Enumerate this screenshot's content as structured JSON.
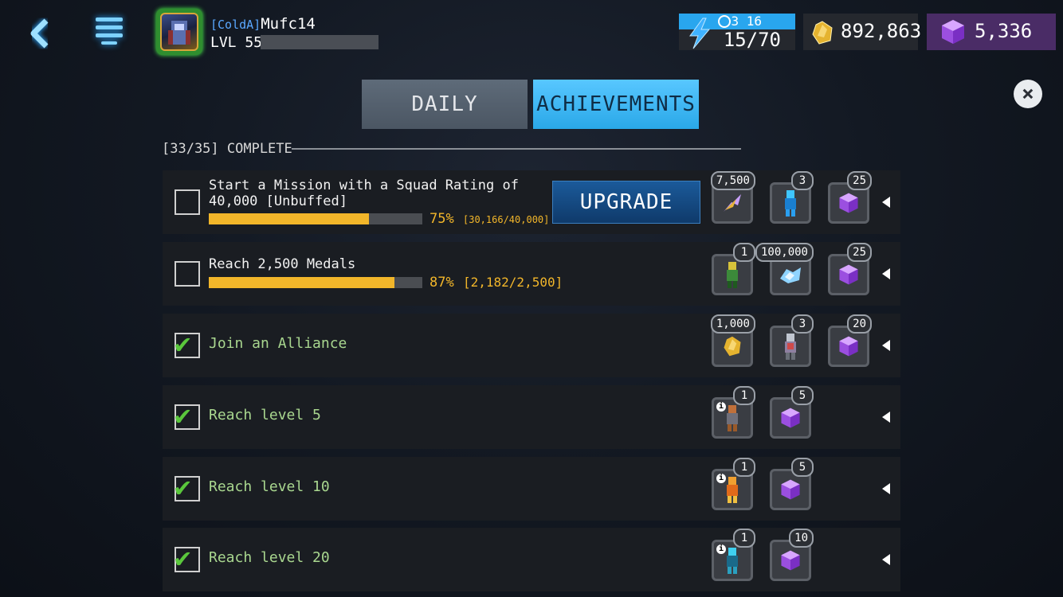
{
  "player": {
    "tag": "[ColdA]",
    "name": "Mufc14",
    "level": "LVL 55"
  },
  "energy": {
    "timer": "3 16",
    "value": "15/70"
  },
  "currency": {
    "gold": "892,863",
    "gems": "5,336"
  },
  "tabs": [
    {
      "label": "DAILY"
    },
    {
      "label": "ACHIEVEMENTS"
    }
  ],
  "completion": "[33/35] COMPLETE",
  "upgrade_label": "UPGRADE",
  "achievements": [
    {
      "title": "Start a Mission with a Squad Rating of 40,000 [Unbuffed]",
      "progress": 0.75,
      "percent": "75%",
      "progress_text": "[30,166/40,000]",
      "checked": false,
      "rewards": [
        {
          "icon": "gold-char-shard-icon",
          "qty": "7,500"
        },
        {
          "icon": "blue-character-icon",
          "qty": "3"
        },
        {
          "icon": "purple-gem-icon",
          "qty": "25"
        }
      ]
    },
    {
      "title": "Reach 2,500 Medals",
      "progress": 0.87,
      "percent": "87%",
      "progress_text": "[2,182/2,500]",
      "checked": false,
      "rewards": [
        {
          "icon": "green-character-icon",
          "qty": "1"
        },
        {
          "icon": "ore-crystal-icon",
          "qty": "100,000"
        },
        {
          "icon": "purple-gem-icon",
          "qty": "25"
        }
      ]
    },
    {
      "title": "Join an Alliance",
      "checked": true,
      "rewards": [
        {
          "icon": "gold-nugget-icon",
          "qty": "1,000"
        },
        {
          "icon": "silver-character-icon",
          "qty": "3"
        },
        {
          "icon": "purple-gem-icon",
          "qty": "20"
        }
      ]
    },
    {
      "title": "Reach level 5",
      "checked": true,
      "rewards": [
        {
          "icon": "orange-character-icon",
          "qty": "1"
        },
        {
          "icon": "purple-gem-icon",
          "qty": "5"
        }
      ]
    },
    {
      "title": "Reach level 10",
      "checked": true,
      "rewards": [
        {
          "icon": "orange-flame-character-icon",
          "qty": "1"
        },
        {
          "icon": "purple-gem-icon",
          "qty": "5"
        }
      ]
    },
    {
      "title": "Reach level 20",
      "checked": true,
      "rewards": [
        {
          "icon": "cyan-character-icon",
          "qty": "1"
        },
        {
          "icon": "purple-gem-icon",
          "qty": "10"
        }
      ]
    }
  ]
}
